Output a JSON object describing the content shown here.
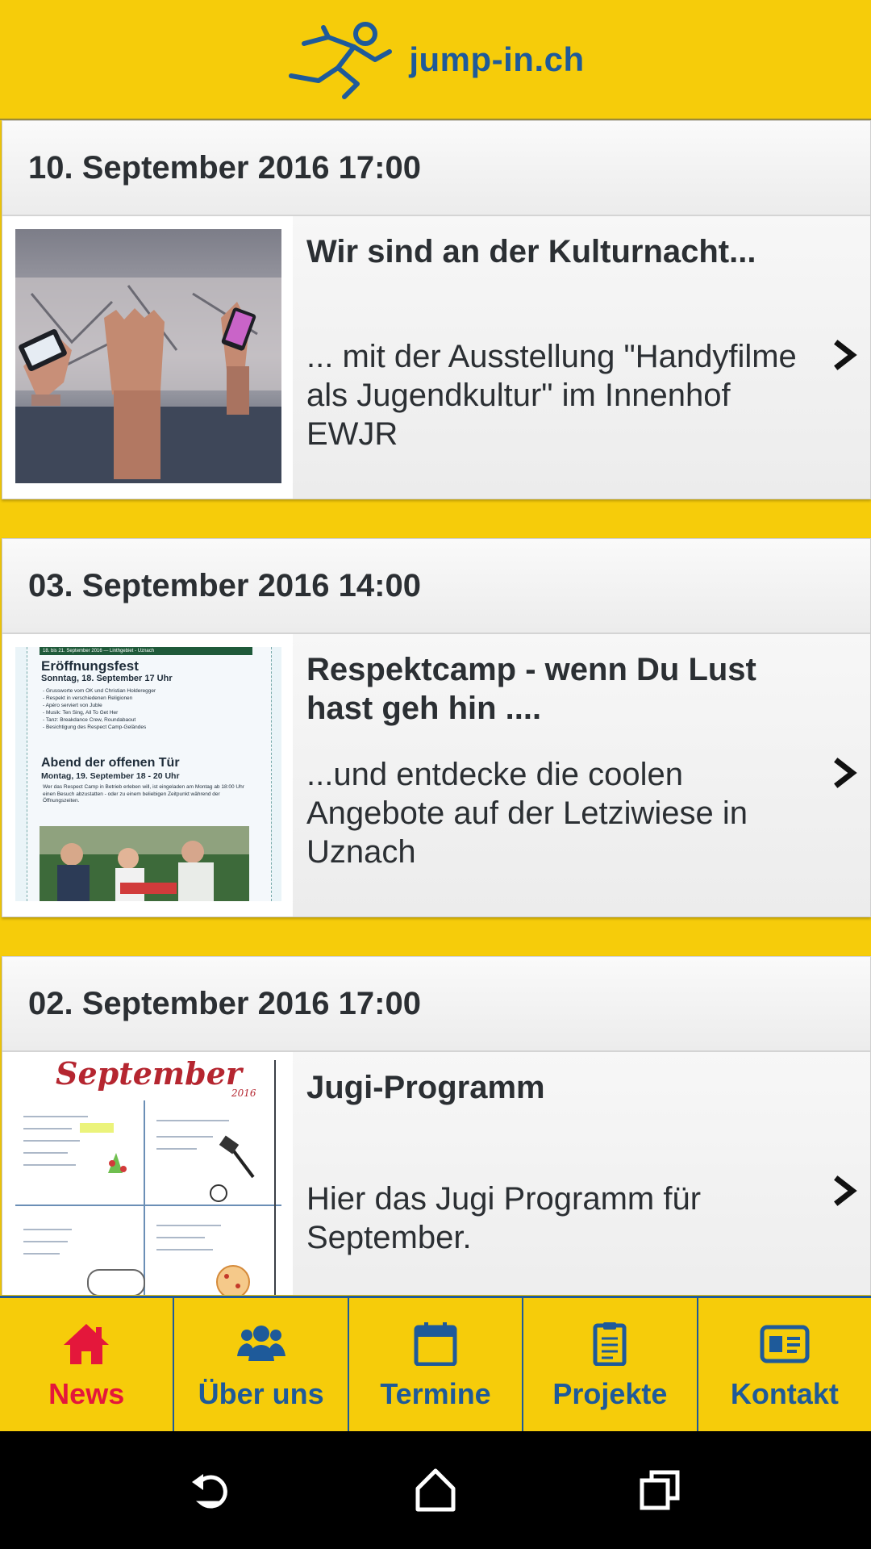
{
  "header": {
    "logo_text": "jump-in.ch",
    "logo_icon": "running-man-icon"
  },
  "news": [
    {
      "date": "10. September 2016 17:00",
      "title": "Wir sind an der Kulturnacht...",
      "text": "... mit der Ausstellung \"Handyfilme als Jugendkultur\" im Innenhof EWJR"
    },
    {
      "date": "03. September 2016 14:00",
      "title": "Respektcamp - wenn Du Lust hast geh hin ....",
      "text": "...und entdecke die coolen Angebote auf der Letziwiese in Uznach",
      "poster": {
        "top": "18. bis 21. September 2016 — Linthgebiet - Uznach",
        "h1": "Eröffnungsfest",
        "h1_sub": "Sonntag, 18. September 17 Uhr",
        "bullets": [
          "- Grussworte vom OK und Christian Holderegger",
          "- Respekt in verschiedenen Religionen",
          "- Apéro serviert von Juble",
          "- Musik: Ten Sing, All To Get Her",
          "- Tanz: Breakdance Crew, Roundabaout",
          "- Besichtigung des Respect Camp-Geländes"
        ],
        "h2": "Abend der offenen Tür",
        "h2_sub": "Montag, 19. September 18 - 20 Uhr",
        "para": "Wer das Respect Camp in Betrieb erleben will, ist eingeladen am Montag ab 18:00 Uhr einen Besuch abzustatten - oder zu einem beliebigen Zeitpunkt während der Öffnungszeiten."
      }
    },
    {
      "date": "02. September 2016 17:00",
      "title": "Jugi-Programm",
      "text": "Hier das Jugi Programm für September.",
      "poster": {
        "title": "September",
        "year": "2016"
      }
    }
  ],
  "tabs": [
    {
      "label": "News",
      "icon": "home-icon",
      "active": true
    },
    {
      "label": "Über uns",
      "icon": "users-icon",
      "active": false
    },
    {
      "label": "Termine",
      "icon": "calendar-icon",
      "active": false
    },
    {
      "label": "Projekte",
      "icon": "clipboard-icon",
      "active": false
    },
    {
      "label": "Kontakt",
      "icon": "contact-card-icon",
      "active": false
    }
  ],
  "system_nav": [
    "back-icon",
    "home-nav-icon",
    "recents-icon"
  ],
  "colors": {
    "brand_yellow": "#f6cc0a",
    "brand_blue": "#1e5a9a",
    "active_red": "#e4173b"
  }
}
